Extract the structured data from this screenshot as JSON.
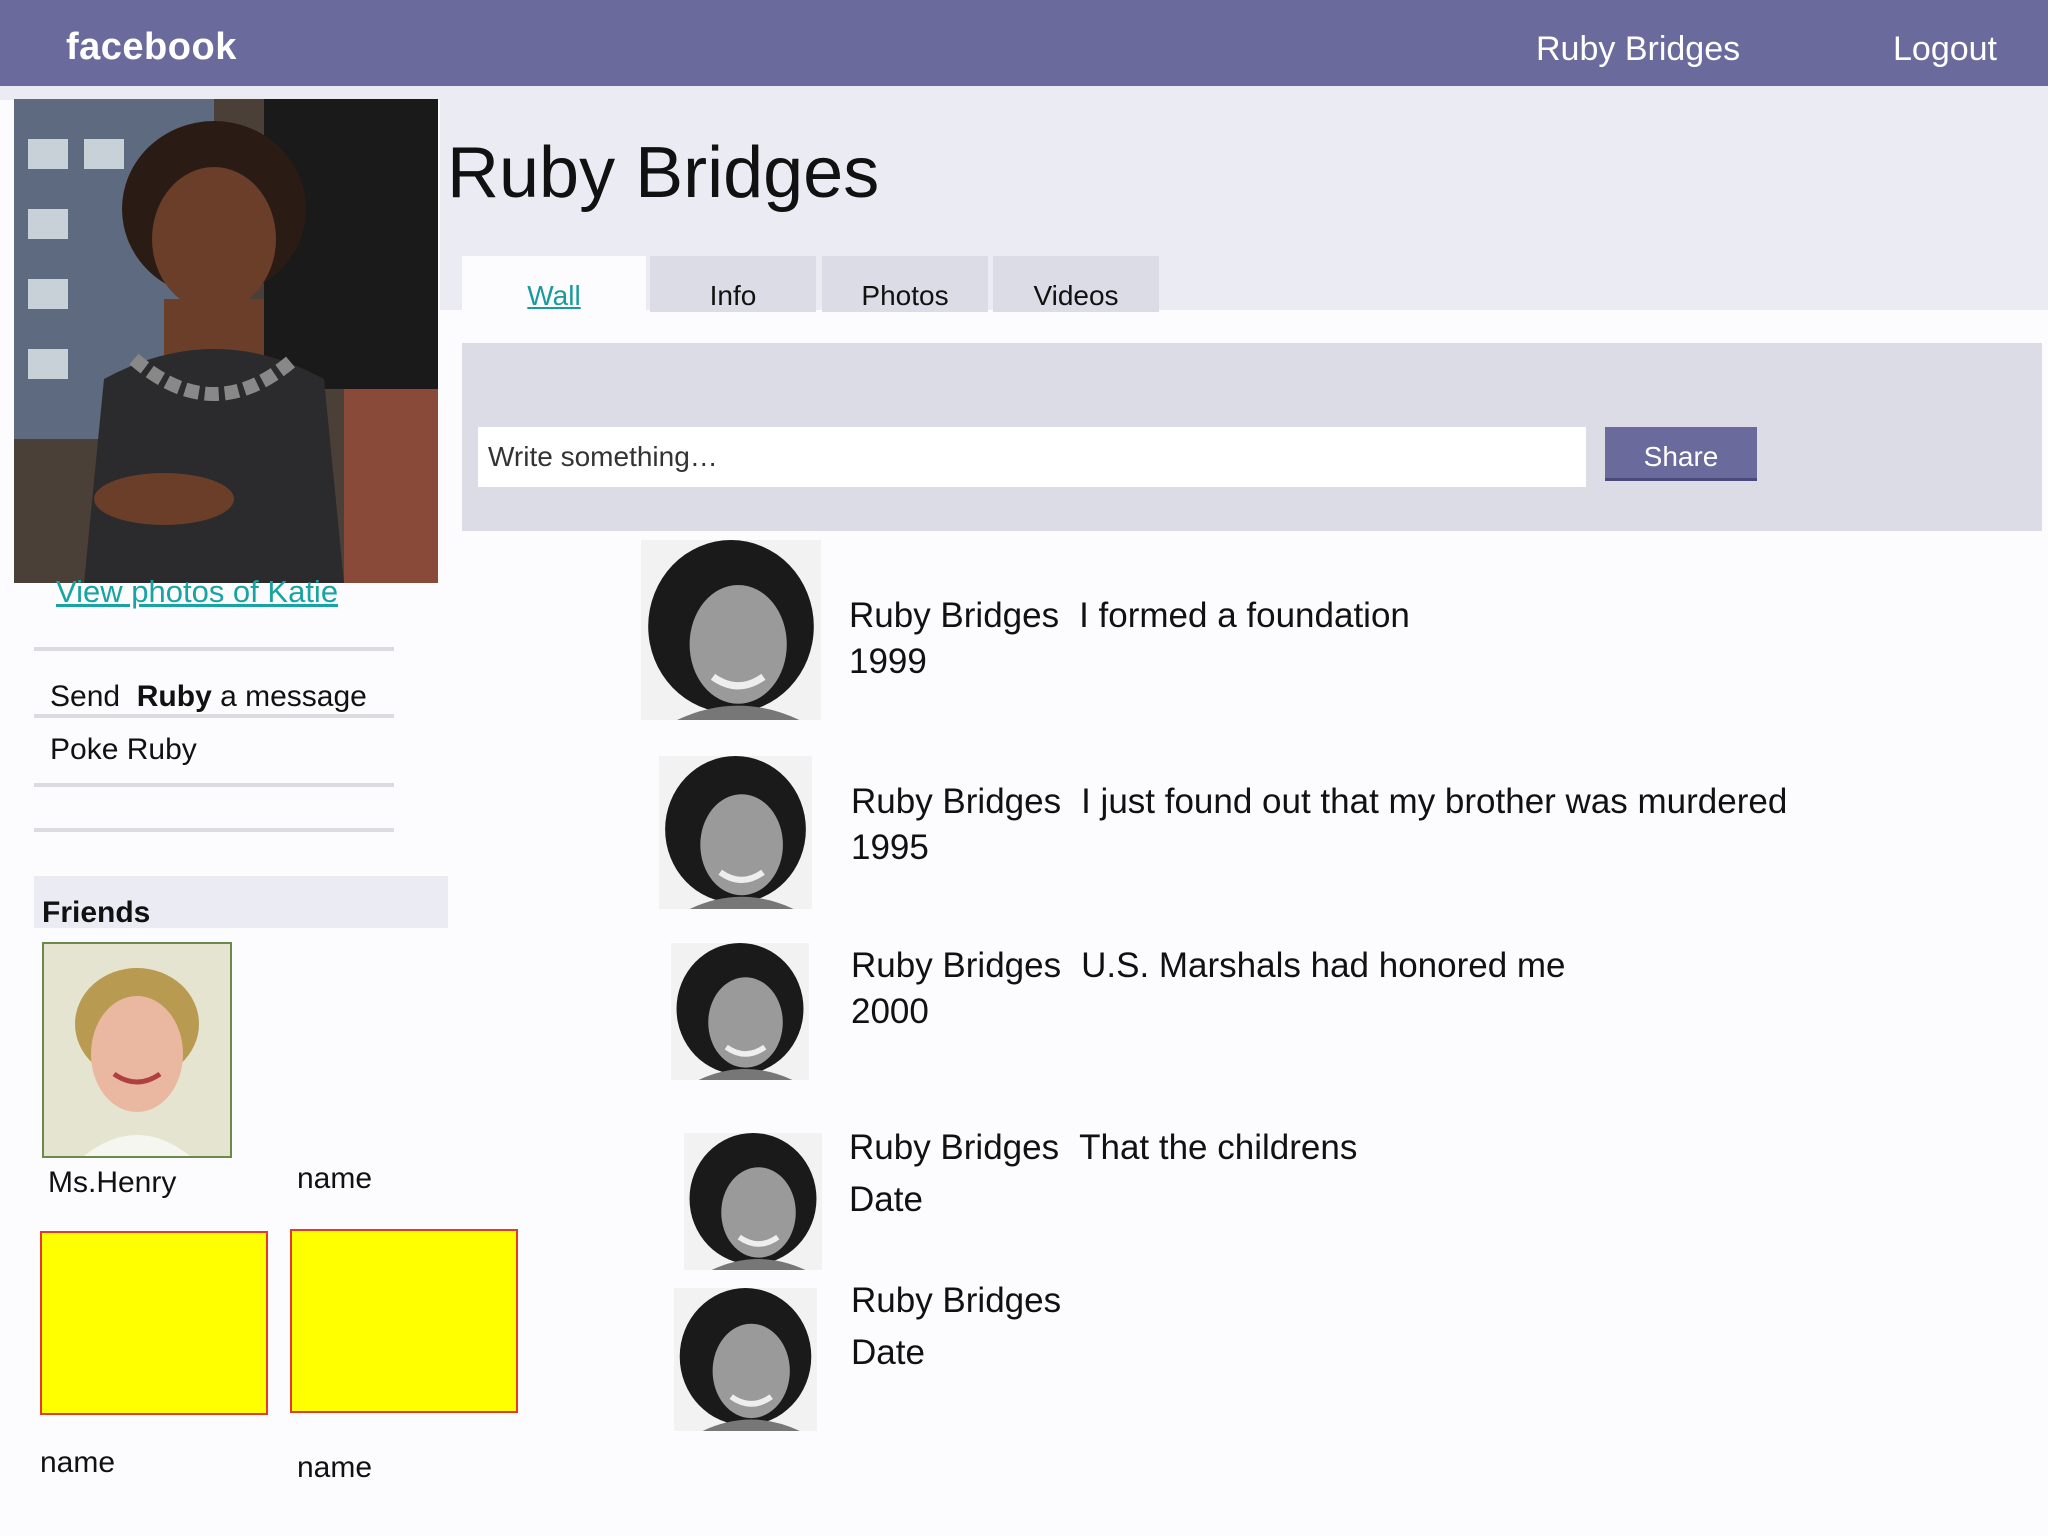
{
  "topbar": {
    "logo": "facebook",
    "user_name": "Ruby Bridges",
    "logout": "Logout",
    "bg_color": "#6b6a9d"
  },
  "profile": {
    "name": "Ruby Bridges",
    "view_photos": "View photos of Katie",
    "send_prefix": "Send",
    "send_name": "Ruby",
    "send_suffix": "a message",
    "poke": "Poke Ruby"
  },
  "tabs": [
    {
      "label": "Wall",
      "active": true
    },
    {
      "label": "Info"
    },
    {
      "label": "Photos"
    },
    {
      "label": "Videos"
    }
  ],
  "composer": {
    "placeholder": "Write something…",
    "share": "Share"
  },
  "friends": {
    "label": "Friends",
    "items": [
      {
        "name": "Ms.Henry"
      },
      {
        "name": "name"
      },
      {
        "name": "name"
      },
      {
        "name": "name"
      }
    ]
  },
  "posts": [
    {
      "author": "Ruby Bridges",
      "text": "I formed a foundation",
      "date": "1999"
    },
    {
      "author": "Ruby Bridges",
      "text": "I just found out that my brother was murdered",
      "date": "1995"
    },
    {
      "author": "Ruby Bridges",
      "text": "U.S. Marshals had honored me",
      "date": "2000"
    },
    {
      "author": "Ruby Bridges",
      "text": "That the childrens",
      "date": "Date"
    },
    {
      "author": "Ruby Bridges",
      "text": "",
      "date": "Date"
    }
  ]
}
